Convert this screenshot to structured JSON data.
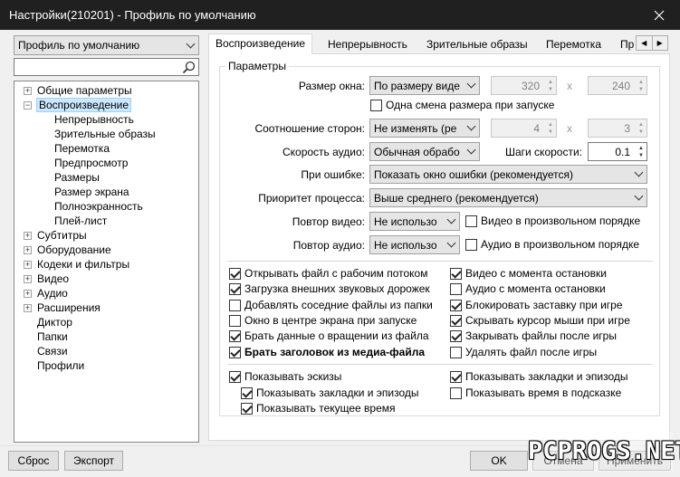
{
  "window": {
    "title": "Настройки(210201) - Профиль по умолчанию"
  },
  "sidebar": {
    "profile_combo": "Профиль по умолчанию",
    "search_placeholder": "",
    "tree": {
      "general": "Общие параметры",
      "playback": "Воспроизведение",
      "continuity": "Непрерывность",
      "visual": "Зрительные образы",
      "rewind": "Перемотка",
      "preview": "Предпросмотр",
      "sizes": "Размеры",
      "screen_size": "Размер экрана",
      "fullscreen": "Полноэкранность",
      "playlist": "Плей-лист",
      "subtitles": "Субтитры",
      "hardware": "Оборудование",
      "codecs": "Кодеки и фильтры",
      "video": "Видео",
      "audio": "Аудио",
      "extensions": "Расширения",
      "announcer": "Диктор",
      "folders": "Папки",
      "links": "Связи",
      "profiles": "Профили"
    }
  },
  "tabs": [
    "Воспроизведение",
    "Непрерывность",
    "Зрительные образы",
    "Перемотка",
    "Пр"
  ],
  "group": {
    "title": "Параметры",
    "window_size": {
      "label": "Размер окна:",
      "value": "По размеру виде",
      "w": "320",
      "h": "240",
      "x": "x"
    },
    "one_resize": "Одна смена размера при запуске",
    "aspect": {
      "label": "Соотношение сторон:",
      "value": "Не изменять (ре",
      "w": "4",
      "h": "3",
      "x": "x"
    },
    "audio_speed": {
      "label": "Скорость аудио:",
      "value": "Обычная обрабо"
    },
    "speed_steps": {
      "label": "Шаги скорости:",
      "value": "0.1"
    },
    "on_error": {
      "label": "При ошибке:",
      "value": "Показать окно ошибки (рекомендуется)"
    },
    "priority": {
      "label": "Приоритет процесса:",
      "value": "Выше среднего (рекомендуется)"
    },
    "repeat_video": {
      "label": "Повтор видео:",
      "value": "Не использо",
      "random": "Видео в произвольном порядке"
    },
    "repeat_audio": {
      "label": "Повтор аудио:",
      "value": "Не использо",
      "random": "Аудио в произвольном порядке"
    }
  },
  "checks": {
    "open_stream": "Открывать файл с рабочим потоком",
    "load_audio": "Загрузка внешних звуковых дорожек",
    "add_neighbors": "Добавлять соседние файлы из папки",
    "center_window": "Окно в центре экрана при запуске",
    "rotation": "Брать данные о вращении из файла",
    "title_from_media": "Брать заголовок из медиа-файла",
    "video_resume": "Видео с момента остановки",
    "audio_resume": "Аудио с момента остановки",
    "block_screensaver": "Блокировать заставку при игре",
    "hide_cursor": "Скрывать курсор мыши при игре",
    "close_after": "Закрывать файлы после игры",
    "delete_after": "Удалять файл после игры",
    "show_thumbs": "Показывать эскизы",
    "show_bookmarks_sub": "Показывать закладки и эпизоды",
    "show_time": "Показывать текущее время",
    "show_bookmarks": "Показывать закладки и эпизоды",
    "show_time_tooltip": "Показывать время в подсказке"
  },
  "footer": {
    "reset": "Сброс",
    "export": "Экспорт",
    "ok": "OK",
    "cancel": "Отмена",
    "apply": "Применить"
  },
  "watermark": "PCPROGS.NET"
}
